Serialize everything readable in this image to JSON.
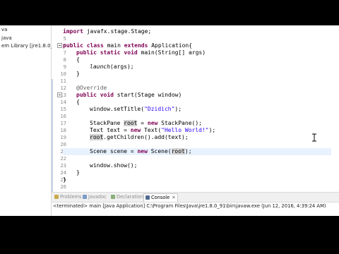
{
  "explorer": {
    "items": [
      {
        "label": "va"
      },
      {
        "label": "java"
      },
      {
        "label": "em Library [jre1.8.0_91]"
      }
    ]
  },
  "editor": {
    "line_numbers": [
      "",
      "5",
      "6",
      "7",
      "8",
      "9",
      "10",
      "11",
      "12",
      "13",
      "14",
      "15",
      "16",
      "17",
      "18",
      "19",
      "20",
      "21",
      "22",
      "23",
      "24",
      "25",
      "26"
    ],
    "code": {
      "l0_import": "import",
      "l0_rest": " javafx.stage.Stage;",
      "l1_kw1": "public class",
      "l1_name": " main ",
      "l1_kw2": "extends",
      "l1_rest": " Application{",
      "l2_kw": "public static void",
      "l2_rest": " main(String[] args)",
      "l3": "{",
      "l4_call": "launch",
      "l4_rest": "(args);",
      "l5": "}",
      "l7_ann": "@Override",
      "l8_kw": "public void",
      "l8_rest": " start(Stage window)",
      "l9": "{",
      "l10_pre": "window.setTitle(",
      "l10_str": "\"Dzidich\"",
      "l10_post": ");",
      "l12_pre": "StackPane ",
      "l12_var": "root",
      "l12_mid": " = ",
      "l12_new": "new",
      "l12_post": " StackPane();",
      "l13_pre": "Text text = ",
      "l13_new": "new",
      "l13_mid": " Text(",
      "l13_str": "\"Hello World!\"",
      "l13_post": ");",
      "l14_var": "root",
      "l14_post": ".getChildren().add(text);",
      "l16_pre": "Scene scene = ",
      "l16_new": "new",
      "l16_mid": " Scene(",
      "l16_var": "root",
      "l16_post": ");",
      "l18": "window.show();",
      "l19": "}",
      "l20": "}"
    }
  },
  "views": {
    "tabs": [
      {
        "label": "Problems"
      },
      {
        "label": "Javadoc"
      },
      {
        "label": "Declaration"
      },
      {
        "label": "Console"
      }
    ],
    "console_status": "<terminated> main [Java Application] C:\\Program Files\\Java\\jre1.8.0_91\\bin\\javaw.exe (Jun 12, 2016, 4:39:24 AM)"
  },
  "colors": {
    "keyword": "#7f0055",
    "string": "#2a00ff",
    "annotation": "#646464",
    "current_line": "#e8f2fe",
    "occurrence_highlight": "#d4d4d4"
  }
}
